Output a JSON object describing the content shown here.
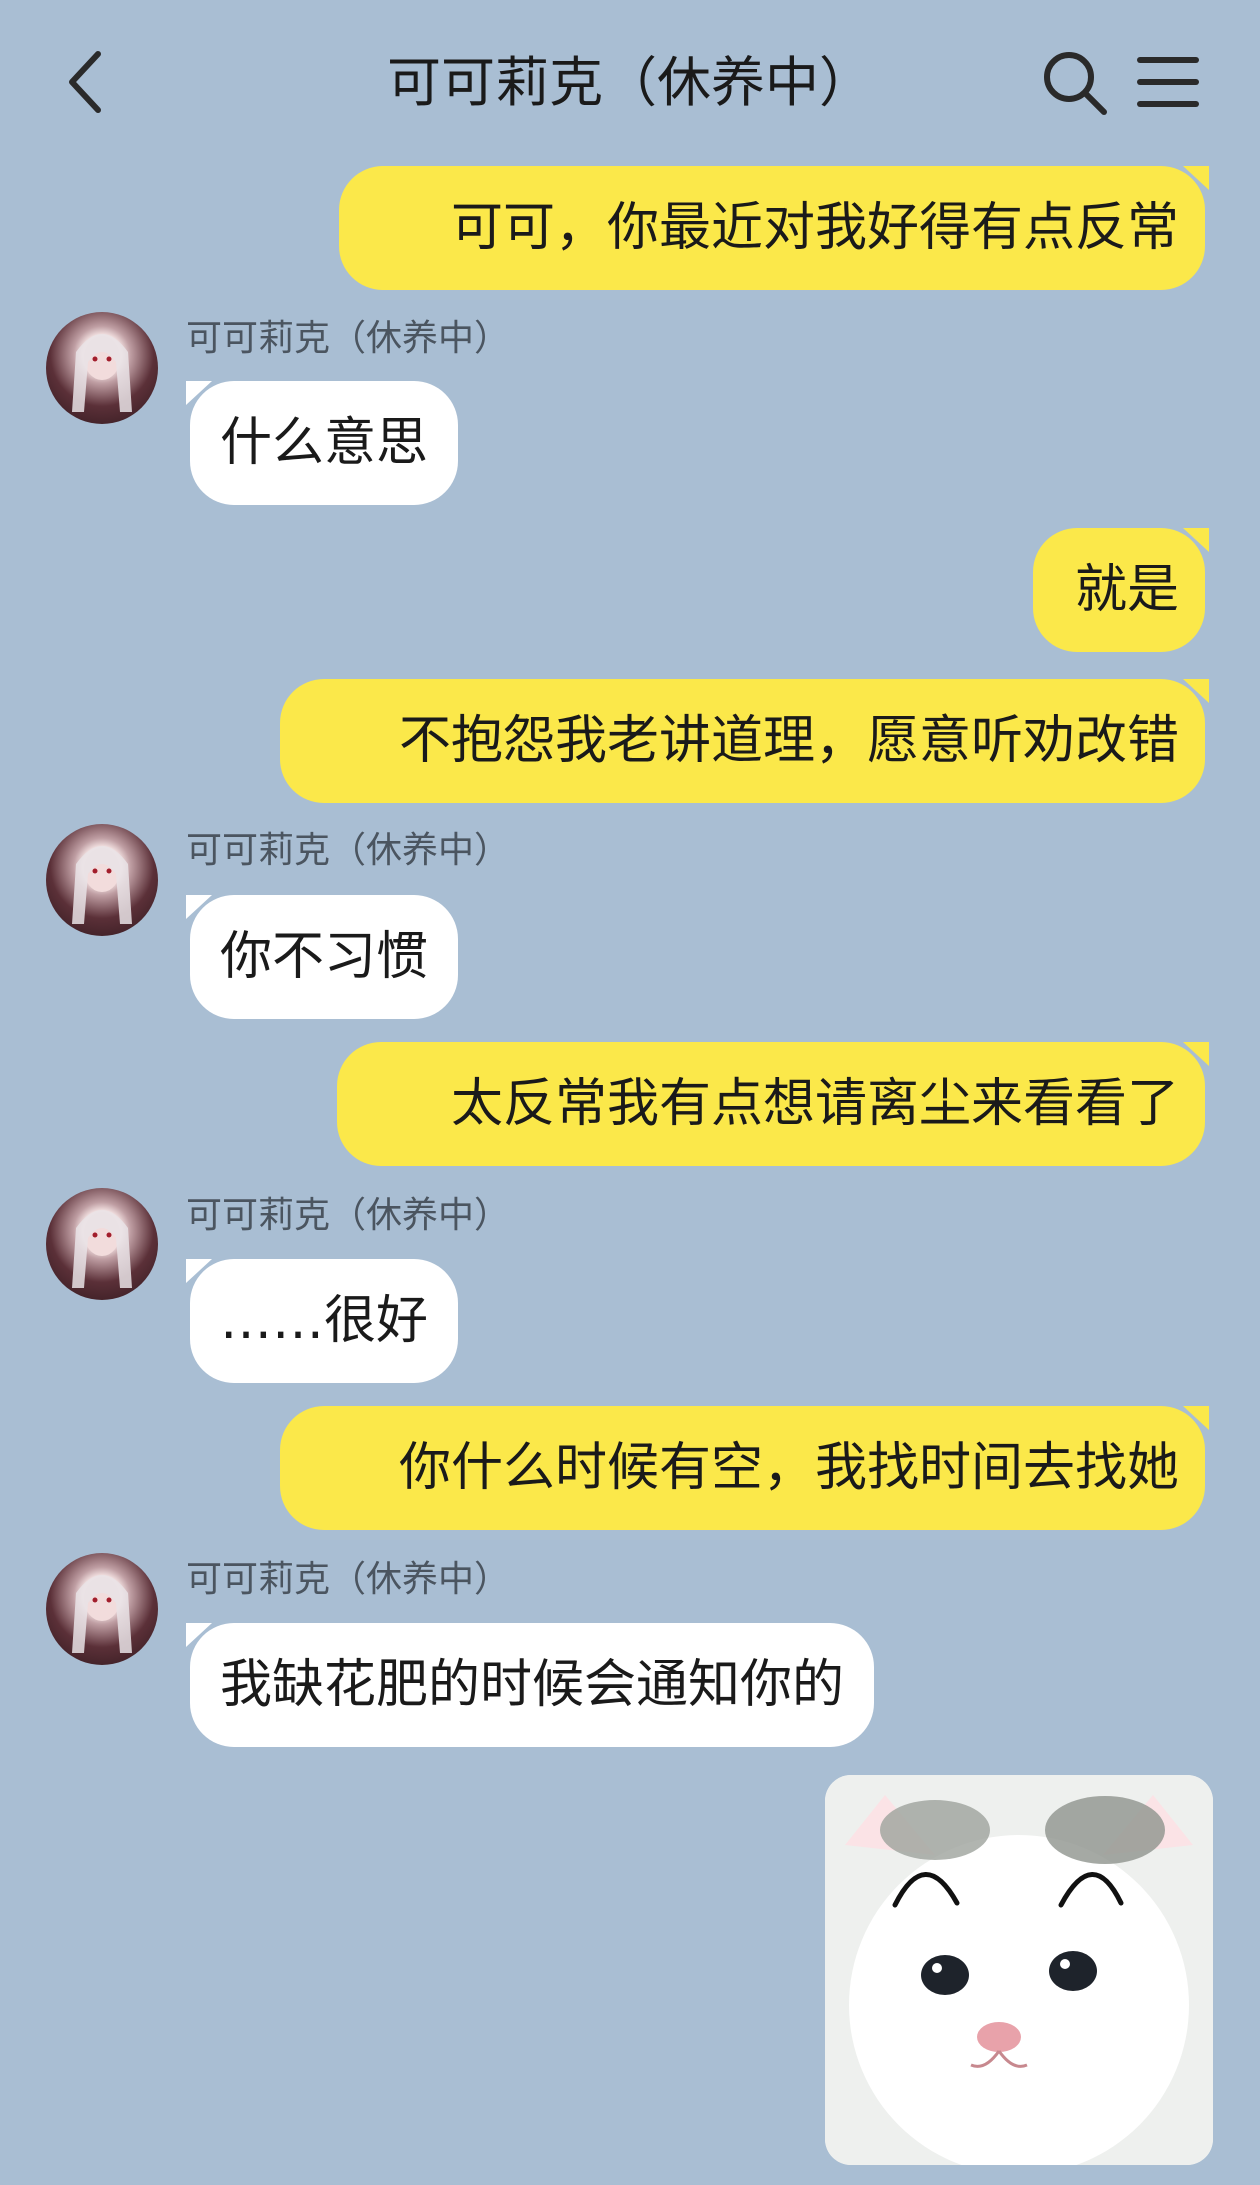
{
  "header": {
    "title": "可可莉克（休养中）",
    "back_icon": "chevron-left-icon",
    "search_icon": "search-icon",
    "menu_icon": "menu-icon"
  },
  "colors": {
    "background": "#a9bed3",
    "outgoing_bubble": "#fbe84a",
    "incoming_bubble": "#ffffff"
  },
  "messages": [
    {
      "direction": "out",
      "text": "可可，你最近对我好得有点反常"
    },
    {
      "direction": "in",
      "sender": "可可莉克（休养中）",
      "text": "什么意思"
    },
    {
      "direction": "out",
      "text": "就是"
    },
    {
      "direction": "out",
      "text": "不抱怨我老讲道理，愿意听劝改错"
    },
    {
      "direction": "in",
      "sender": "可可莉克（休养中）",
      "text": "你不习惯"
    },
    {
      "direction": "out",
      "text": "太反常我有点想请离尘来看看了"
    },
    {
      "direction": "in",
      "sender": "可可莉克（休养中）",
      "text": "……很好"
    },
    {
      "direction": "out",
      "text": "你什么时候有空，我找时间去找她"
    },
    {
      "direction": "in",
      "sender": "可可莉克（休养中）",
      "text": "我缺花肥的时候会通知你的"
    },
    {
      "direction": "out",
      "type": "sticker",
      "sticker": "white-kitten-sticker"
    }
  ]
}
